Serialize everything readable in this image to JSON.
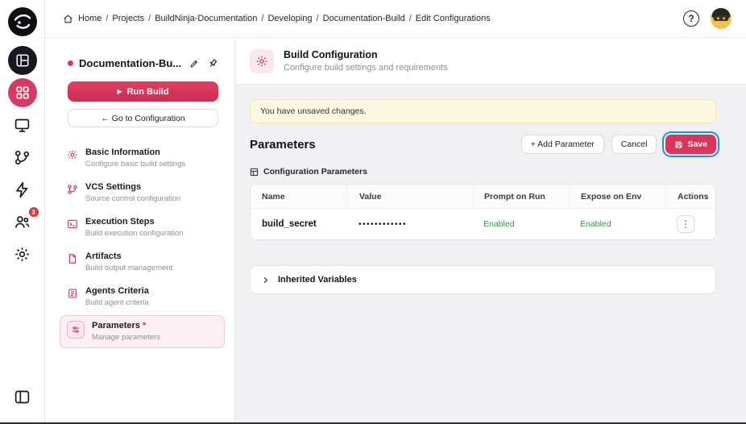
{
  "colors": {
    "accent": "#d63964",
    "save_button_bg": "#d8365d",
    "focus_ring_blue": "#1f8fe0",
    "enabled_green": "#2da23a",
    "warning_bg": "#fcf8e0",
    "badge_red": "#e03434"
  },
  "icons": {
    "play": "▶",
    "kebab": "⋮"
  },
  "rail": {
    "users_badge": "3"
  },
  "topbar": {
    "separator": "/",
    "crumbs": [
      "Home",
      "Projects",
      "BuildNinja-Documentation",
      "Developing",
      "Documentation-Build",
      "Edit Configurations"
    ],
    "help_label": "?"
  },
  "sidebar": {
    "project_title": "Documentation-Bu...",
    "run_button": "Run Build",
    "goto_button": "← Go to Configuration",
    "nav": [
      {
        "title": "Basic Information",
        "subtitle": "Configure basic build settings"
      },
      {
        "title": "VCS Settings",
        "subtitle": "Source control configuration"
      },
      {
        "title": "Execution Steps",
        "subtitle": "Build execution configuration"
      },
      {
        "title": "Artifacts",
        "subtitle": "Build output management"
      },
      {
        "title": "Agents Criteria",
        "subtitle": "Build agent criteria"
      },
      {
        "title": "Parameters",
        "subtitle": "Manage parameters",
        "required_mark": "*"
      }
    ]
  },
  "main": {
    "header": {
      "title": "Build Configuration",
      "subtitle": "Configure build settings and requirements"
    },
    "warning": "You have unsaved changes.",
    "section_title": "Parameters",
    "add_parameter_button": "+ Add Parameter",
    "cancel_button": "Cancel",
    "save_button": "Save",
    "config_params_label": "Configuration Parameters",
    "table": {
      "columns": [
        "Name",
        "Value",
        "Prompt on Run",
        "Expose on Env",
        "Actions"
      ],
      "rows": [
        {
          "name": "build_secret",
          "value": "••••••••••••",
          "prompt_on_run": "Enabled",
          "expose_on_env": "Enabled"
        }
      ]
    },
    "inherited_panel": {
      "label": "Inherited Variables"
    }
  }
}
